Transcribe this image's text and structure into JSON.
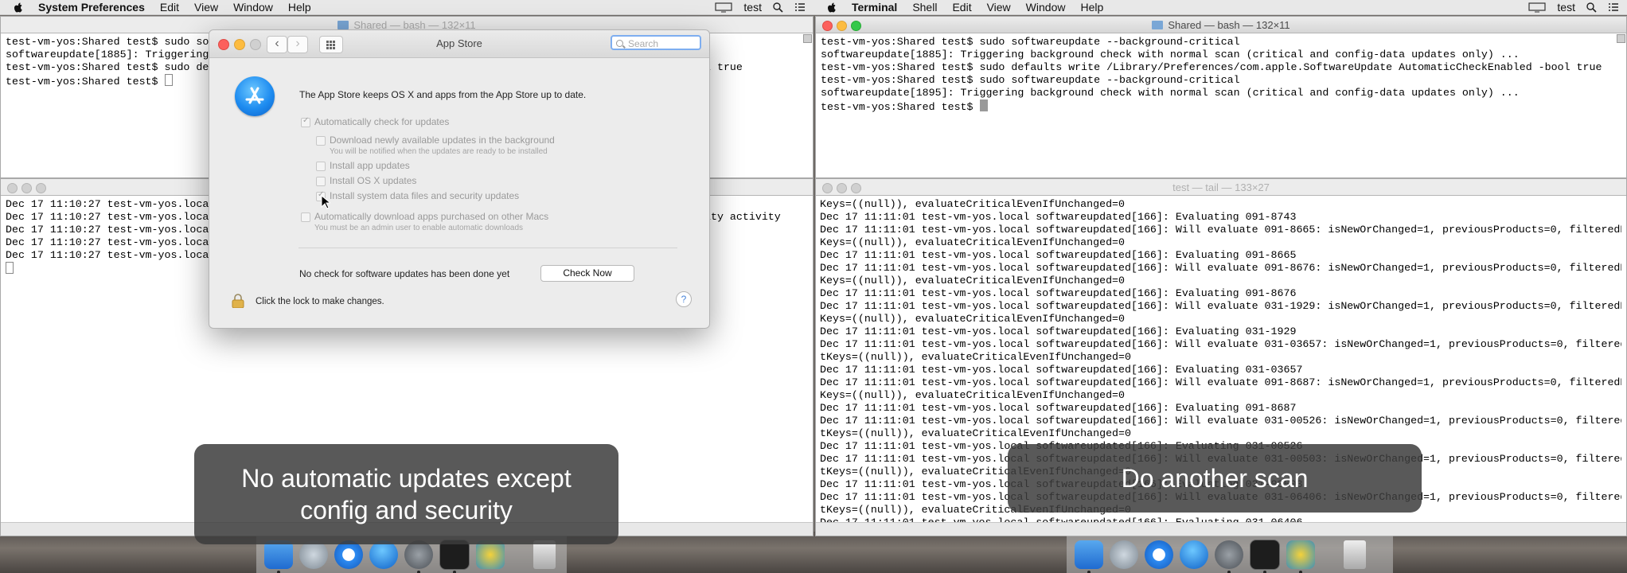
{
  "left": {
    "menubar": {
      "app_name": "System Preferences",
      "items": [
        "Edit",
        "View",
        "Window",
        "Help"
      ],
      "user": "test"
    },
    "terminal_top": {
      "title": "Shared — bash — 132×11",
      "lines": [
        "test-vm-yos:Shared test$ sudo soft",
        "softwareupdate[1885]: Triggering b",
        "test-vm-yos:Shared test$ sudo defa",
        "test-vm-yos:Shared test$ "
      ],
      "right_fragment_line3": "l true"
    },
    "terminal_bottom": {
      "lines": [
        "Dec 17 11:10:27 test-vm-yos.local",
        "Dec 17 11:10:27 test-vm-yos.local",
        "Dec 17 11:10:27 test-vm-yos.local",
        "Dec 17 11:10:27 test-vm-yos.local",
        "Dec 17 11:10:27 test-vm-yos.local"
      ],
      "right_fragment_line2": "ity activity"
    },
    "appstore": {
      "title": "App Store",
      "search_placeholder": "Search",
      "description": "The App Store keeps OS X and apps from the App Store up to date.",
      "options": [
        {
          "label": "Automatically check for updates",
          "checked": true
        },
        {
          "label": "Download newly available updates in the background",
          "checked": false
        },
        {
          "label": "Install app updates",
          "checked": false
        },
        {
          "label": "Install OS X updates",
          "checked": false
        },
        {
          "label": "Install system data files and security updates",
          "checked": true
        },
        {
          "label": "Automatically download apps purchased on other Macs",
          "checked": false
        }
      ],
      "download_note": "You will be notified when the updates are ready to be installed",
      "admin_note": "You must be an admin user to enable automatic downloads",
      "status": "No check for software updates has been done yet",
      "check_now": "Check Now",
      "lock_text": "Click the lock to make changes.",
      "help": "?"
    },
    "caption": "No automatic updates except\nconfig and security"
  },
  "right": {
    "menubar": {
      "app_name": "Terminal",
      "items": [
        "Shell",
        "Edit",
        "View",
        "Window",
        "Help"
      ],
      "user": "test"
    },
    "terminal_top": {
      "title": "Shared — bash — 132×11",
      "lines": [
        "test-vm-yos:Shared test$ sudo softwareupdate --background-critical",
        "softwareupdate[1885]: Triggering background check with normal scan (critical and config-data updates only) ...",
        "test-vm-yos:Shared test$ sudo defaults write /Library/Preferences/com.apple.SoftwareUpdate AutomaticCheckEnabled -bool true",
        "test-vm-yos:Shared test$ sudo softwareupdate --background-critical",
        "softwareupdate[1895]: Triggering background check with normal scan (critical and config-data updates only) ...",
        "test-vm-yos:Shared test$ "
      ]
    },
    "terminal_bottom": {
      "title": "test — tail — 133×27",
      "lines": [
        "Keys=((null)), evaluateCriticalEvenIfUnchanged=0",
        "Dec 17 11:11:01 test-vm-yos.local softwareupdated[166]: Evaluating 091-8743",
        "Dec 17 11:11:01 test-vm-yos.local softwareupdated[166]: Will evaluate 091-8665: isNewOrChanged=1, previousProducts=0, filteredProduct",
        "Keys=((null)), evaluateCriticalEvenIfUnchanged=0",
        "Dec 17 11:11:01 test-vm-yos.local softwareupdated[166]: Evaluating 091-8665",
        "Dec 17 11:11:01 test-vm-yos.local softwareupdated[166]: Will evaluate 091-8676: isNewOrChanged=1, previousProducts=0, filteredProduct",
        "Keys=((null)), evaluateCriticalEvenIfUnchanged=0",
        "Dec 17 11:11:01 test-vm-yos.local softwareupdated[166]: Evaluating 091-8676",
        "Dec 17 11:11:01 test-vm-yos.local softwareupdated[166]: Will evaluate 031-1929: isNewOrChanged=1, previousProducts=0, filteredProduct",
        "Keys=((null)), evaluateCriticalEvenIfUnchanged=0",
        "Dec 17 11:11:01 test-vm-yos.local softwareupdated[166]: Evaluating 031-1929",
        "Dec 17 11:11:01 test-vm-yos.local softwareupdated[166]: Will evaluate 031-03657: isNewOrChanged=1, previousProducts=0, filteredProduc",
        "tKeys=((null)), evaluateCriticalEvenIfUnchanged=0",
        "Dec 17 11:11:01 test-vm-yos.local softwareupdated[166]: Evaluating 031-03657",
        "Dec 17 11:11:01 test-vm-yos.local softwareupdated[166]: Will evaluate 091-8687: isNewOrChanged=1, previousProducts=0, filteredProduct",
        "Keys=((null)), evaluateCriticalEvenIfUnchanged=0",
        "Dec 17 11:11:01 test-vm-yos.local softwareupdated[166]: Evaluating 091-8687",
        "Dec 17 11:11:01 test-vm-yos.local softwareupdated[166]: Will evaluate 031-00526: isNewOrChanged=1, previousProducts=0, filteredProduc",
        "tKeys=((null)), evaluateCriticalEvenIfUnchanged=0",
        "Dec 17 11:11:01 test-vm-yos.local softwareupdated[166]: Evaluating 031-00526",
        "Dec 17 11:11:01 test-vm-yos.local softwareupdated[166]: Will evaluate 031-00503: isNewOrChanged=1, previousProducts=0, filteredProduc",
        "tKeys=((null)), evaluateCriticalEvenIfUnchanged=0",
        "Dec 17 11:11:01 test-vm-yos.local softwareupdated[166]: Evaluating 031-00503",
        "Dec 17 11:11:01 test-vm-yos.local softwareupdated[166]: Will evaluate 031-06406: isNewOrChanged=1, previousProducts=0, filteredProduc",
        "tKeys=((null)), evaluateCriticalEvenIfUnchanged=0",
        "Dec 17 11:11:01 test-vm-yos.local softwareupdated[166]: Evaluating 031-06406"
      ]
    },
    "caption": "Do another scan"
  },
  "icons": {
    "apple": "apple-logo-icon",
    "airplay": "display-icon",
    "search": "spotlight-search-icon",
    "list": "notification-list-icon"
  },
  "colors": {
    "close": "#fc605c",
    "minimize": "#fdbc40",
    "zoom": "#34c84a",
    "search_focus": "#7eaef0"
  }
}
